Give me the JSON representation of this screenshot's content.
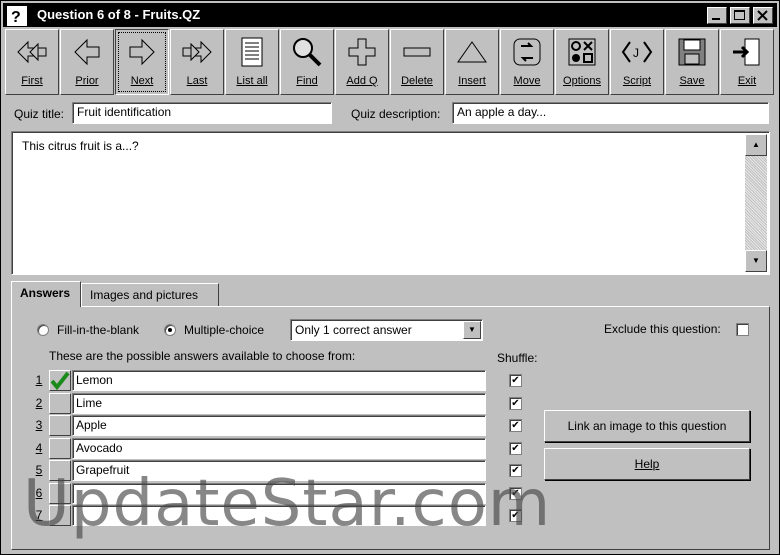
{
  "window": {
    "title": "Question 6 of 8 - Fruits.QZ"
  },
  "toolbar": [
    {
      "label": "First",
      "icon": "first-icon"
    },
    {
      "label": "Prior",
      "icon": "prior-icon"
    },
    {
      "label": "Next",
      "icon": "next-icon"
    },
    {
      "label": "Last",
      "icon": "last-icon"
    },
    {
      "label": "List all",
      "icon": "list-icon"
    },
    {
      "label": "Find",
      "icon": "magnifier-icon"
    },
    {
      "label": "Add Q",
      "icon": "plus-icon"
    },
    {
      "label": "Delete",
      "icon": "minus-icon"
    },
    {
      "label": "Insert",
      "icon": "triangle-icon"
    },
    {
      "label": "Move",
      "icon": "move-icon"
    },
    {
      "label": "Options",
      "icon": "options-icon"
    },
    {
      "label": "Script",
      "icon": "script-icon"
    },
    {
      "label": "Save",
      "icon": "floppy-icon"
    },
    {
      "label": "Exit",
      "icon": "exit-icon"
    }
  ],
  "quiz": {
    "title_label": "Quiz title:",
    "title_value": "Fruit identification",
    "desc_label": "Quiz description:",
    "desc_value": "An apple a day..."
  },
  "question": {
    "text": "This citrus fruit is a...?"
  },
  "tabs": {
    "answers": "Answers",
    "images": "Images and pictures"
  },
  "answers_panel": {
    "fill_blank_label": "Fill-in-the-blank",
    "multiple_choice_label": "Multiple-choice",
    "selected_type": "multiple-choice",
    "mode_value": "Only 1 correct answer",
    "exclude_label": "Exclude this question:",
    "exclude_checked": false,
    "possible_label": "These are the possible answers available to choose from:",
    "shuffle_label": "Shuffle:",
    "answers": [
      {
        "num": "1",
        "text": "Lemon",
        "correct": true,
        "shuffle": true
      },
      {
        "num": "2",
        "text": "Lime",
        "correct": false,
        "shuffle": true
      },
      {
        "num": "3",
        "text": "Apple",
        "correct": false,
        "shuffle": true
      },
      {
        "num": "4",
        "text": "Avocado",
        "correct": false,
        "shuffle": true
      },
      {
        "num": "5",
        "text": "Grapefruit",
        "correct": false,
        "shuffle": true
      },
      {
        "num": "6",
        "text": "",
        "correct": false,
        "shuffle": true
      },
      {
        "num": "7",
        "text": "",
        "correct": false,
        "shuffle": true
      }
    ],
    "link_image_label": "Link an image to this question",
    "help_label": "Help"
  },
  "watermark": "UpdateStar.com",
  "colors": {
    "titlebar": "#000000",
    "face": "#c0c0c0",
    "check": "#1a8a1a"
  }
}
